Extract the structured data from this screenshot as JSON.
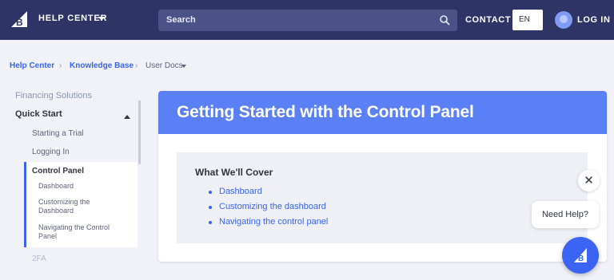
{
  "header": {
    "help_center_label": "HELP CENTER",
    "search_placeholder": "Search",
    "contact_label": "CONTACT",
    "language": "EN",
    "login_label": "LOG IN"
  },
  "breadcrumb": {
    "items": [
      "Help Center",
      "Knowledge Base",
      "User Docs"
    ],
    "separator": "›"
  },
  "sidebar": {
    "section_heading": "Financing Solutions",
    "group_label": "Quick Start",
    "items": [
      {
        "label": "Starting a Trial"
      },
      {
        "label": "Logging In"
      },
      {
        "label": "Control Panel",
        "active": true
      }
    ],
    "sub_items": [
      {
        "label": "Dashboard"
      },
      {
        "label": "Customizing the Dashboard"
      },
      {
        "label": "Navigating the Control Panel"
      }
    ],
    "next_item": "2FA"
  },
  "article": {
    "title": "Getting Started with the Control Panel",
    "cover_title": "What We'll Cover",
    "cover_links": [
      "Dashboard",
      "Customizing the dashboard",
      "Navigating the control panel"
    ]
  },
  "help_widget": {
    "close_symbol": "✕",
    "need_help_label": "Need Help?"
  },
  "colors": {
    "nav_background": "#2e3566",
    "accent": "#3c64f4",
    "header_banner": "#5b80f5"
  },
  "icons": {
    "logo": "bigcommerce-logo-icon",
    "search": "search-icon",
    "avatar": "user-avatar-icon",
    "help_fab": "bigcommerce-help-icon"
  }
}
